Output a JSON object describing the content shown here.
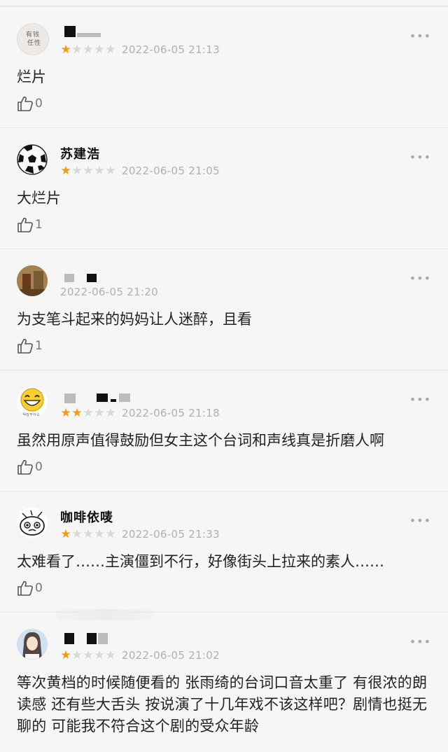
{
  "colors": {
    "star_on": "#f29a16",
    "star_off": "#d8d8d8",
    "date": "#b0b0b0",
    "background": "#f6f6f6"
  },
  "icons": {
    "rating": "star-icon",
    "like": "thumbs-up-icon",
    "more": "more-dots-icon"
  },
  "more_label": "•••",
  "star_char": "★",
  "reviews": [
    {
      "username": "",
      "rating": 1,
      "show_stars": true,
      "date": "2022-06-05 21:13",
      "content": "烂片",
      "likes": "0"
    },
    {
      "username": "苏建浩",
      "rating": 1,
      "show_stars": true,
      "date": "2022-06-05 21:05",
      "content": "大烂片",
      "likes": "1"
    },
    {
      "username": "",
      "rating": 0,
      "show_stars": false,
      "date": "2022-06-05 21:20",
      "content": "为支笔斗起来的妈妈让人迷醉，且看",
      "likes": "1"
    },
    {
      "username": "",
      "rating": 2,
      "show_stars": true,
      "date": "2022-06-05 21:18",
      "content": "虽然用原声值得鼓励但女主这个台词和声线真是折磨人啊",
      "likes": "0"
    },
    {
      "username": "咖啡依唛",
      "rating": 1,
      "show_stars": true,
      "date": "2022-06-05 21:33",
      "content": "太难看了……主演僵到不行，好像街头上拉来的素人……",
      "likes": "0"
    },
    {
      "username": "",
      "rating": 1,
      "show_stars": true,
      "date": "2022-06-05 21:02",
      "content": "等次黄档的时候随便看的 张雨绮的台词口音太重了 有很浓的朗读感 还有些大舌头 按说演了十几年戏不该这样吧？剧情也挺无聊的 可能我不符合这个剧的受众年龄",
      "likes": ""
    }
  ]
}
